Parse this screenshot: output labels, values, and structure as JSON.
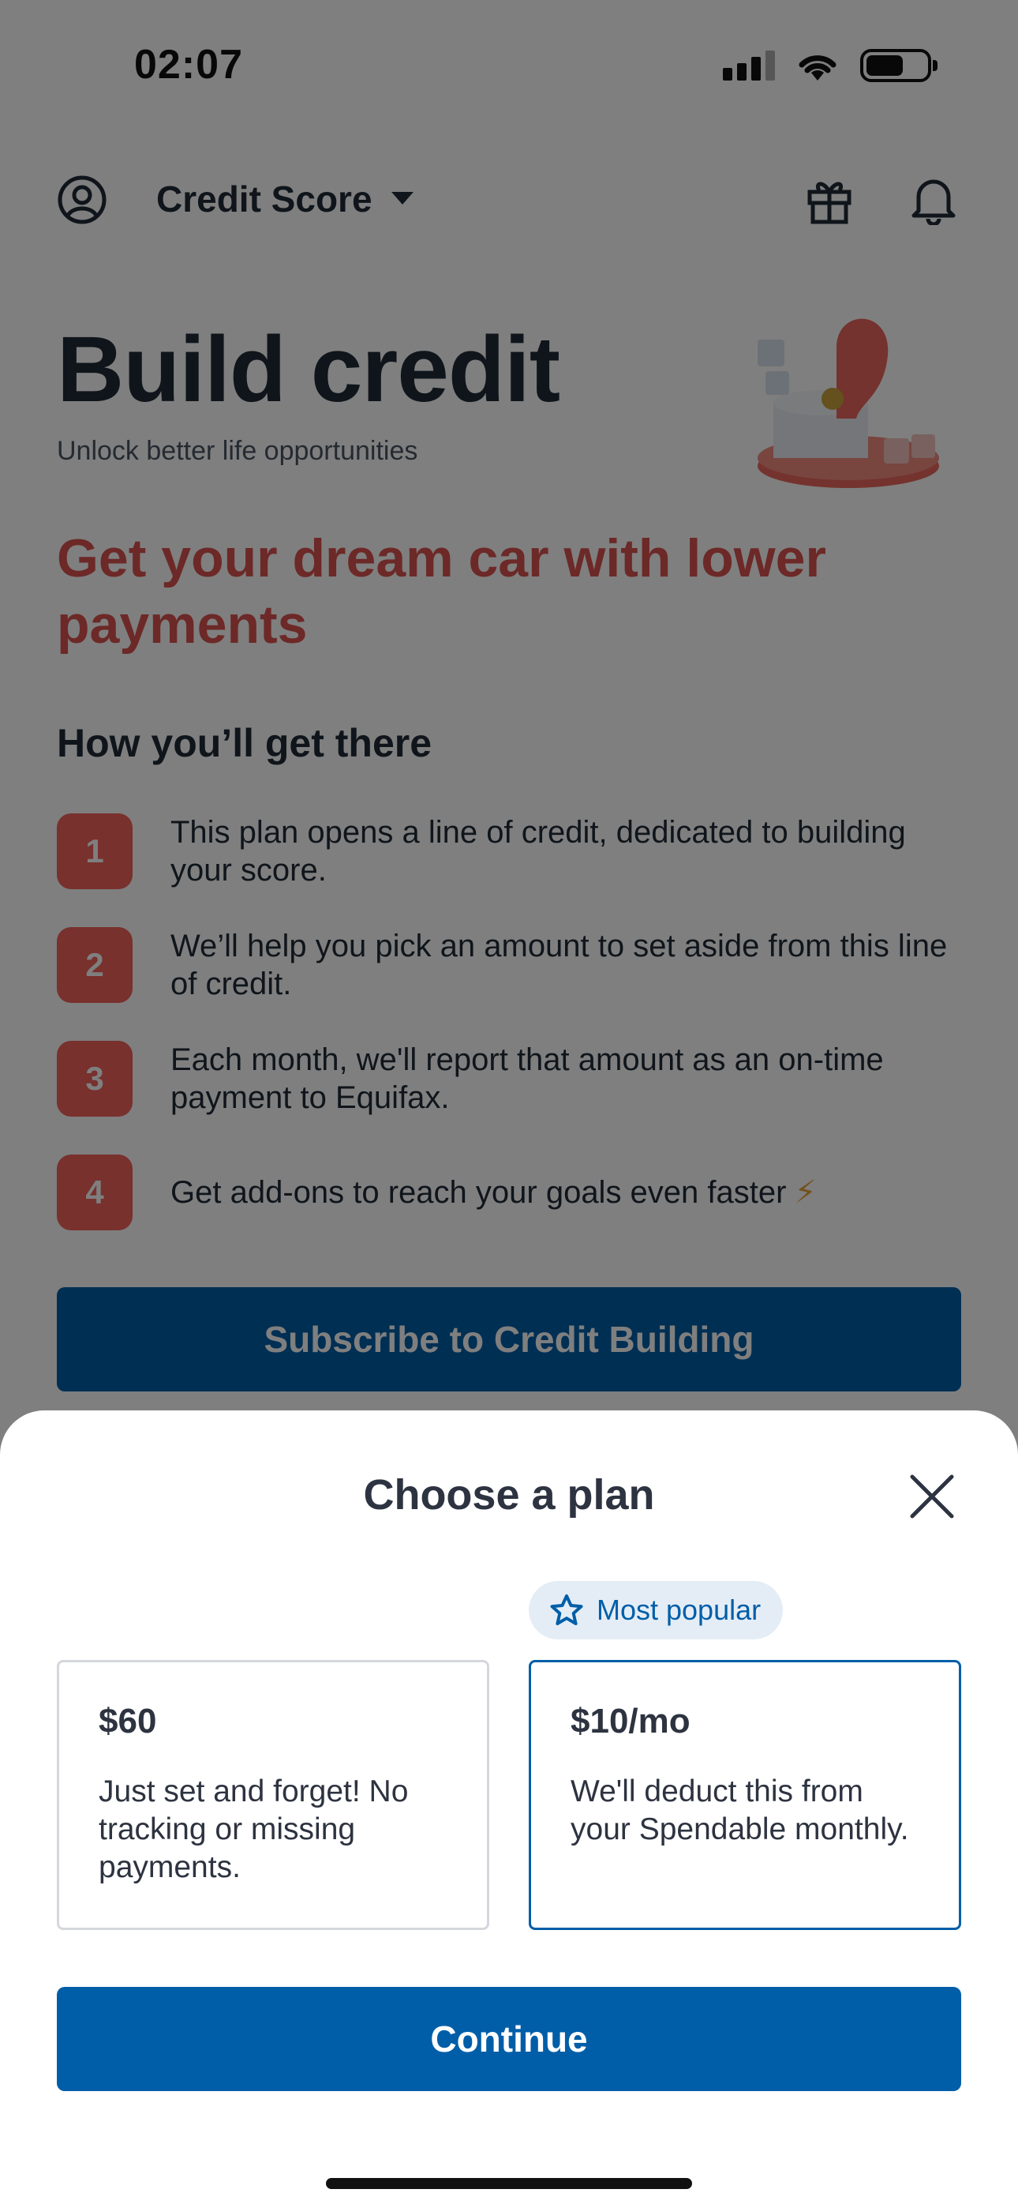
{
  "status_bar": {
    "time": "02:07"
  },
  "header": {
    "selector_label": "Credit Score"
  },
  "hero": {
    "title": "Build credit",
    "subtitle": "Unlock better life opportunities"
  },
  "goal": {
    "text": "Get your dream car with lower payments"
  },
  "steps": {
    "heading": "How you’ll get there",
    "items": [
      {
        "number": "1",
        "text": "This plan opens a line of credit, dedicated to building your score."
      },
      {
        "number": "2",
        "text": "We’ll help you pick an amount to set aside from this line of credit."
      },
      {
        "number": "3",
        "text": "Each month, we'll report that amount as an on-time payment to Equifax."
      },
      {
        "number": "4",
        "text": "Get add-ons to reach your goals even faster",
        "emoji": "⚡"
      }
    ]
  },
  "subscribe_button": {
    "label": "Subscribe to Credit Building"
  },
  "sheet": {
    "title": "Choose a plan",
    "badge": "Most popular",
    "plans": [
      {
        "price": "$60",
        "description": "Just set and forget! No tracking or missing payments.",
        "selected": false
      },
      {
        "price": "$10/mo",
        "description": "We'll deduct this from your Spendable monthly.",
        "selected": true
      }
    ],
    "continue_label": "Continue"
  },
  "colors": {
    "primary": "#005ea8",
    "accent": "#f0625a",
    "goal_text": "#d9534f",
    "badge_bg": "#e4edf6"
  },
  "icons": [
    "profile-icon",
    "chevron-down-icon",
    "gift-icon",
    "bell-icon",
    "star-icon",
    "close-icon",
    "signal-icon",
    "wifi-icon",
    "battery-icon"
  ]
}
